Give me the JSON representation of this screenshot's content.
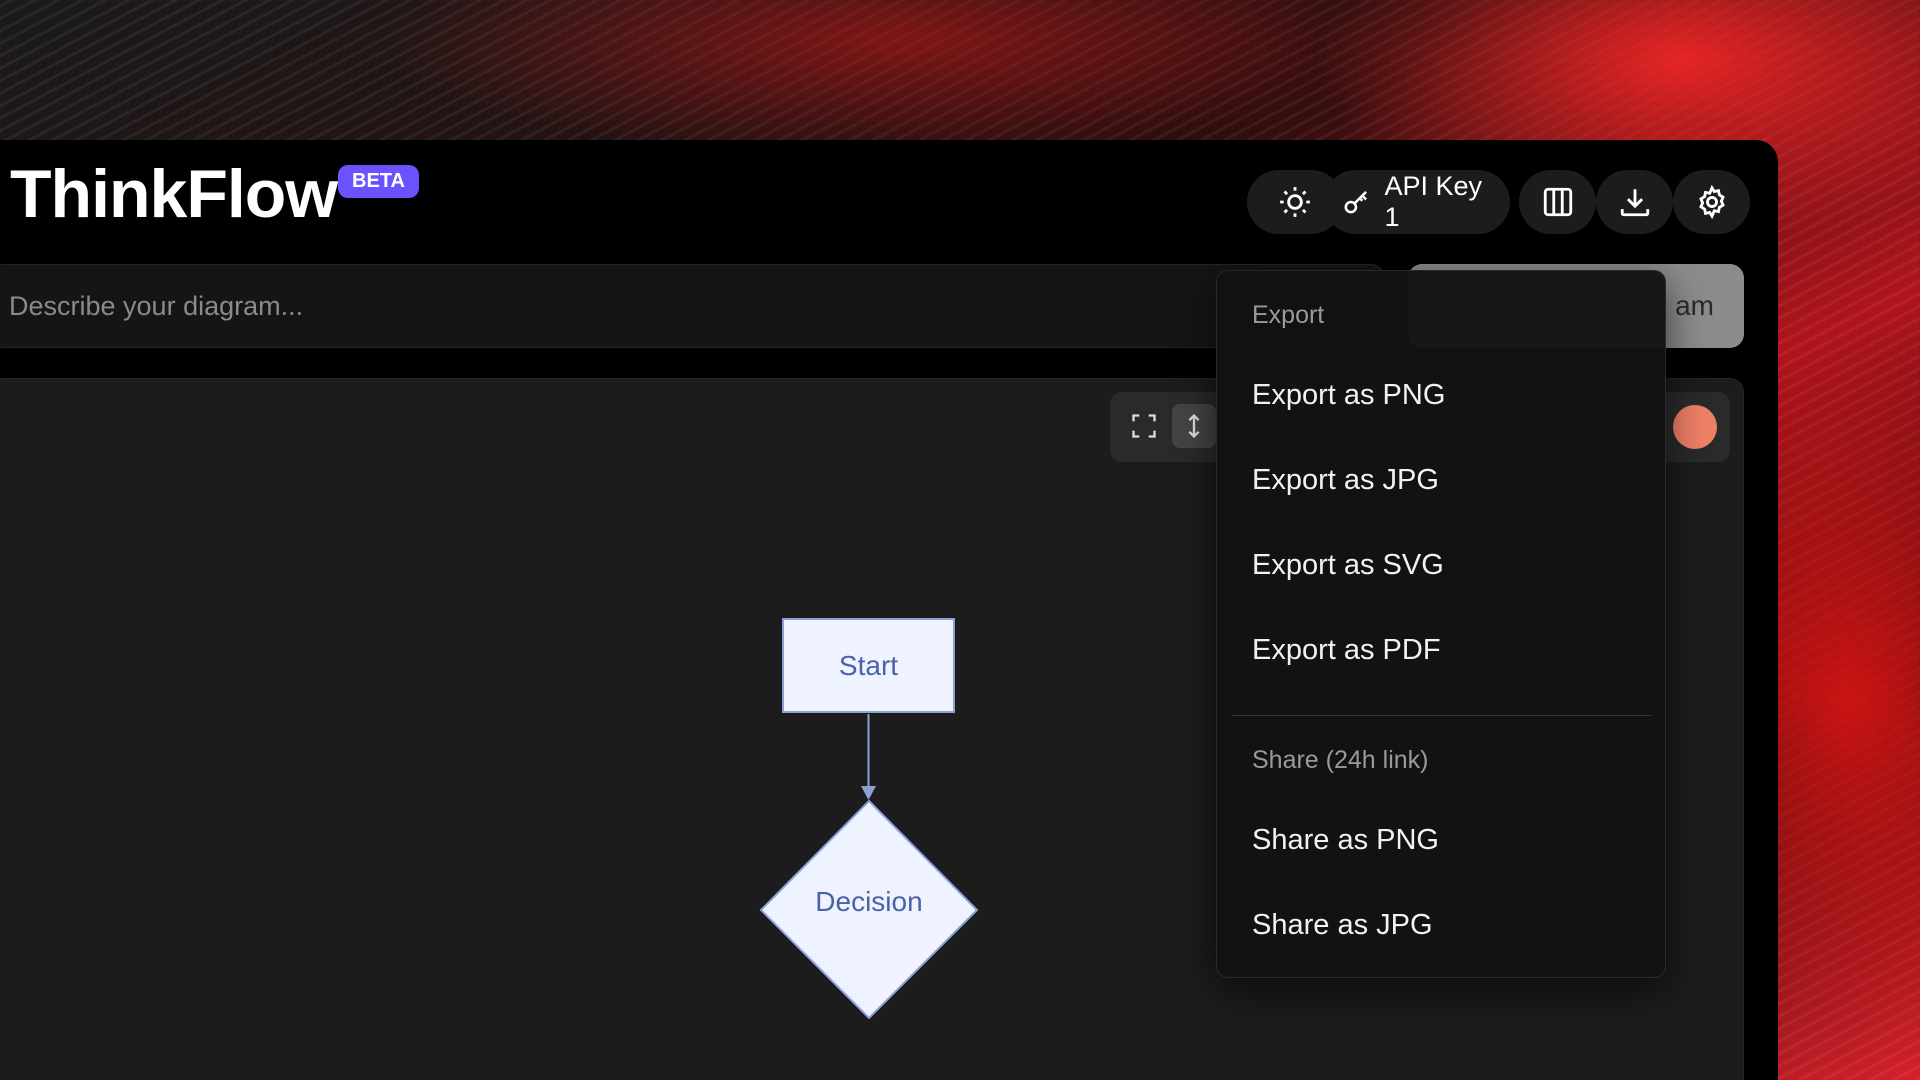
{
  "app": {
    "name": "ThinkFlow",
    "badge": "BETA"
  },
  "toolbar": {
    "theme_icon": "sun-icon",
    "api_key": {
      "icon": "key-icon",
      "label": "API Key 1"
    },
    "layout_icon": "columns-icon",
    "download_icon": "download-icon",
    "settings_icon": "gear-icon"
  },
  "prompt": {
    "placeholder": "Describe your diagram...",
    "value": ""
  },
  "generate_button": {
    "visible_label": "am"
  },
  "canvas_toolbar": {
    "fullscreen_icon": "expand-icon",
    "fit_icon": "vertical-resize-icon",
    "accent": "#ee8066"
  },
  "diagram": {
    "nodes": [
      {
        "id": "start",
        "shape": "rectangle",
        "label": "Start"
      },
      {
        "id": "decision",
        "shape": "diamond",
        "label": "Decision"
      }
    ],
    "edges": [
      {
        "from": "start",
        "to": "decision"
      }
    ],
    "node_fill": "#eef3ff",
    "node_stroke": "#8ba1d6",
    "text_color": "#4a62a8"
  },
  "export_menu": {
    "export_heading": "Export",
    "export_items": [
      "Export as PNG",
      "Export as JPG",
      "Export as SVG",
      "Export as PDF"
    ],
    "share_heading": "Share (24h link)",
    "share_items": [
      "Share as PNG",
      "Share as JPG"
    ]
  },
  "colors": {
    "beta_badge": "#6a52ff",
    "background_accent": "#d8202a"
  }
}
